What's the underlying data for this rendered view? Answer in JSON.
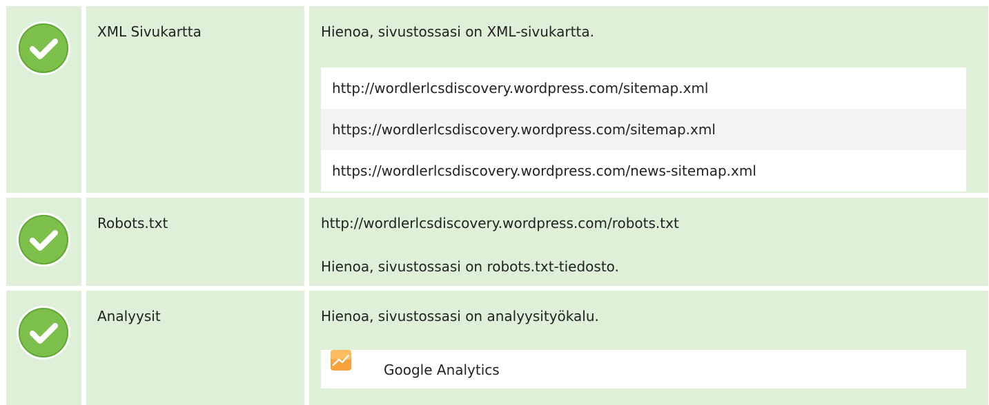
{
  "rows": [
    {
      "label": "XML Sivukartta",
      "status": "pass",
      "message": "Hienoa, sivustossasi on XML-sivukartta.",
      "sitemaps": [
        "http://wordlerlcsdiscovery.wordpress.com/sitemap.xml",
        "https://wordlerlcsdiscovery.wordpress.com/sitemap.xml",
        "https://wordlerlcsdiscovery.wordpress.com/news-sitemap.xml"
      ]
    },
    {
      "label": "Robots.txt",
      "status": "pass",
      "url": "http://wordlerlcsdiscovery.wordpress.com/robots.txt",
      "message": "Hienoa, sivustossasi on robots.txt-tiedosto."
    },
    {
      "label": "Analyysit",
      "status": "pass",
      "message": "Hienoa, sivustossasi on analyysityökalu.",
      "tools": [
        {
          "name": "Google Analytics",
          "icon": "google-analytics-icon"
        }
      ]
    }
  ],
  "colors": {
    "row_bg": "#dff0d8",
    "check_green": "#7cc04b",
    "check_ring": "#ffffff",
    "text": "#222222",
    "list_alt": "#f4f4f4",
    "analytics_orange": "#f7a23a"
  },
  "icons": {
    "status": "check-circle-icon"
  }
}
